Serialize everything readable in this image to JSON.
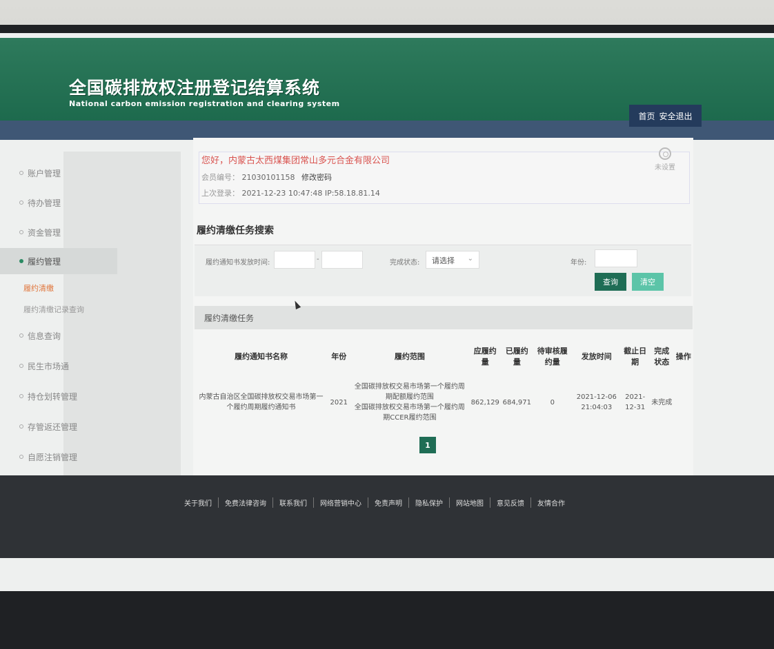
{
  "brand": {
    "title": "全国碳排放权注册登记结算系统",
    "subtitle": "National carbon emission registration and clearing system"
  },
  "topnav": {
    "home": "首页",
    "logout": "安全退出"
  },
  "sidebar": {
    "items": [
      {
        "label": "账户管理"
      },
      {
        "label": "待办管理"
      },
      {
        "label": "资金管理"
      },
      {
        "label": "履约管理"
      },
      {
        "label": "信息查询"
      },
      {
        "label": "民生市场通"
      },
      {
        "label": "持仓划转管理"
      },
      {
        "label": "存管返还管理"
      },
      {
        "label": "自愿注销管理"
      }
    ],
    "sub": [
      {
        "label": "履约清缴"
      },
      {
        "label": "履约清缴记录查询"
      }
    ]
  },
  "account": {
    "greeting": "您好，内蒙古太西煤集团常山多元合金有限公司",
    "member_label": "会员编号：",
    "member_id": "21030101158",
    "change_pwd": "修改密码",
    "last_login_label": "上次登录：",
    "last_login": "2021-12-23 10:47:48",
    "ip_label": "IP:",
    "ip": "58.18.81.14",
    "settings": "未设置"
  },
  "search": {
    "title": "履约清缴任务搜索",
    "date_label": "履约通知书发放时间:",
    "dash": "-",
    "status_label": "完成状态:",
    "status_value": "请选择",
    "year_label": "年份:",
    "query": "查询",
    "clear": "清空"
  },
  "tasks": {
    "title": "履约清缴任务",
    "columns": [
      "履约通知书名称",
      "年份",
      "履约范围",
      "应履约量",
      "已履约量",
      "待审核履约量",
      "发放时间",
      "截止日期",
      "完成状态",
      "操作"
    ],
    "rows": [
      {
        "name": "内蒙古自治区全国碳排放权交易市场第一个履约周期履约通知书",
        "year": "2021",
        "scope1": "全国碳排放权交易市场第一个履约周期配额履约范围",
        "scope2": "全国碳排放权交易市场第一个履约周期CCER履约范围",
        "due": "862,129",
        "done": "684,971",
        "pending": "0",
        "issued": "2021-12-06 21:04:03",
        "deadline": "2021-12-31",
        "status": "未完成",
        "op": ""
      }
    ]
  },
  "pager": {
    "current": "1"
  },
  "footer": [
    "关于我们",
    "免费法律咨询",
    "联系我们",
    "网络营销中心",
    "免责声明",
    "隐私保护",
    "网站地图",
    "意见反馈",
    "友情合作"
  ]
}
